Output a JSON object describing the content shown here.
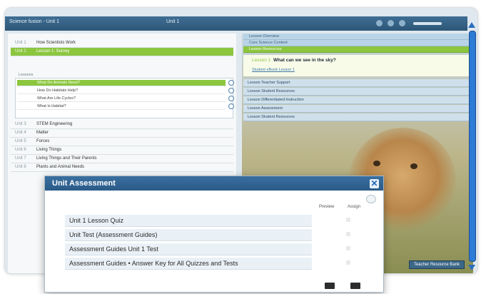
{
  "app": {
    "title": "Science fusion - Unit 1",
    "location": "Unit 1"
  },
  "toc": {
    "units": [
      {
        "num": "Unit 1",
        "label": "How Scientists Work"
      },
      {
        "num": "Unit 2",
        "label": "Lesson 1: Survey"
      },
      {
        "num": "Unit 3",
        "label": "STEM Engineering"
      },
      {
        "num": "Unit 4",
        "label": "Matter"
      },
      {
        "num": "Unit 5",
        "label": "Forces"
      },
      {
        "num": "Unit 6",
        "label": "Living Things"
      },
      {
        "num": "Unit 7",
        "label": "Living Things and Their Parents"
      },
      {
        "num": "Unit 8",
        "label": "Plants and Animal Needs"
      }
    ],
    "lessons_header": "Lessons",
    "lessons": [
      {
        "label": "What Do Animals Need?"
      },
      {
        "label": "How Do Habitats Help?"
      },
      {
        "label": "What Are Life Cycles?"
      },
      {
        "label": "What Is Habitat?"
      }
    ]
  },
  "lesson": {
    "tabs": [
      "Lesson Overview",
      "Core Science Content",
      "Lesson Resources"
    ],
    "question_number": "Lesson 1",
    "question": "What can we see in the sky?",
    "link": "Student eBook Lesson 1",
    "groups": [
      "Lesson Teacher Support",
      "Lesson Student Resources",
      "Lesson Differentiated Instruction",
      "Lesson Assessment",
      "Lesson Student Resources"
    ],
    "bank_label": "Teacher Resource Bank"
  },
  "dialog": {
    "title": "Unit Assessment",
    "close_label": "✕",
    "col_preview": "Preview",
    "col_assign": "Assign",
    "items": [
      {
        "label": "Unit 1 Lesson Quiz"
      },
      {
        "label": "Unit Test (Assessment Guides)"
      },
      {
        "label": "Assessment Guides  Unit 1 Test"
      },
      {
        "label": "Assessment Guides • Answer Key for All Quizzes and Tests"
      }
    ]
  },
  "colors": {
    "selection": "#8cc63f",
    "header": "#2c5677",
    "scrollbar": "#2e7bd6"
  }
}
